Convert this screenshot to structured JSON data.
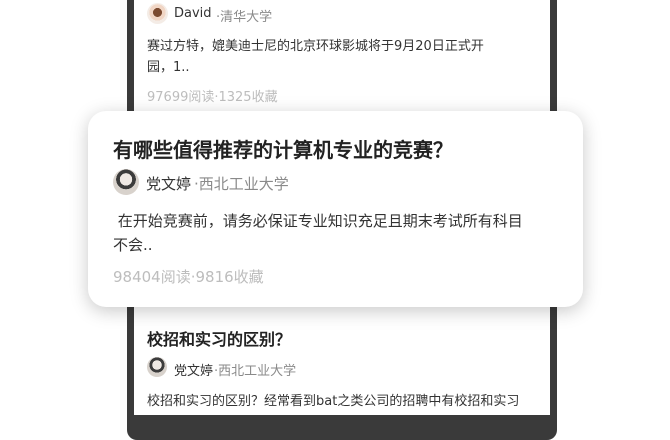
{
  "feed": {
    "top_card": {
      "author": "David",
      "school": "·清华大学",
      "snippet_line1": "赛过方特，媲美迪士尼的北京环球影城将于9月20日正式开",
      "snippet_line2": "园，1..",
      "stats": "97699阅读·1325收藏"
    },
    "highlight_card": {
      "title": "有哪些值得推荐的计算机专业的竞赛？",
      "author": "党文婷",
      "school": "·西北工业大学",
      "snippet_line1": " 在开始竞赛前，请务必保证专业知识充足且期末考试所有科目",
      "snippet_line2": "不会..",
      "stats": "98404阅读·9816收藏"
    },
    "bottom_card": {
      "title": "校招和实习的区别？",
      "author": "党文婷",
      "school": "·西北工业大学",
      "snippet_line1": "校招和实习的区别？经常看到bat之类公司的招聘中有校招和实习"
    }
  }
}
